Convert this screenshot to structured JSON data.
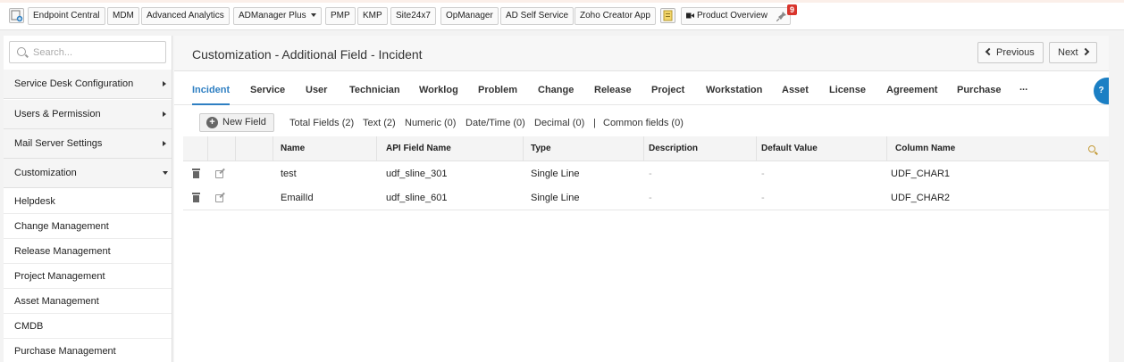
{
  "toolbar": {
    "buttons": [
      {
        "label": "Endpoint Central"
      },
      {
        "label": "MDM"
      },
      {
        "label": "Advanced Analytics"
      },
      {
        "label": "ADManager Plus"
      },
      {
        "label": "PMP"
      },
      {
        "label": "KMP"
      },
      {
        "label": "Site24x7"
      },
      {
        "label": "OpManager"
      },
      {
        "label": "AD Self Service"
      },
      {
        "label": "Zoho Creator App"
      },
      {
        "label": "Product Overview"
      }
    ],
    "notification_count": "9"
  },
  "sidebar": {
    "search_placeholder": "Search...",
    "menu": [
      {
        "label": "Service Desk Configuration"
      },
      {
        "label": "Users & Permission"
      },
      {
        "label": "Mail Server Settings"
      },
      {
        "label": "Customization"
      }
    ],
    "sub_items": [
      {
        "label": "Helpdesk"
      },
      {
        "label": "Change Management"
      },
      {
        "label": "Release Management"
      },
      {
        "label": "Project Management"
      },
      {
        "label": "Asset Management"
      },
      {
        "label": "CMDB"
      },
      {
        "label": "Purchase Management"
      }
    ]
  },
  "main": {
    "title": "Customization - Additional Field - Incident",
    "previous_label": "Previous",
    "next_label": "Next",
    "tabs": [
      {
        "label": "Incident"
      },
      {
        "label": "Service"
      },
      {
        "label": "User"
      },
      {
        "label": "Technician"
      },
      {
        "label": "Worklog"
      },
      {
        "label": "Problem"
      },
      {
        "label": "Change"
      },
      {
        "label": "Release"
      },
      {
        "label": "Project"
      },
      {
        "label": "Workstation"
      },
      {
        "label": "Asset"
      },
      {
        "label": "License"
      },
      {
        "label": "Agreement"
      },
      {
        "label": "Purchase"
      },
      {
        "label": "..."
      }
    ],
    "help_label": "?",
    "new_field_label": "New Field",
    "counts": [
      {
        "label": "Total Fields (2)"
      },
      {
        "label": "Text (2)"
      },
      {
        "label": "Numeric (0)"
      },
      {
        "label": "Date/Time (0)"
      },
      {
        "label": "Decimal (0)"
      },
      {
        "label": "|"
      },
      {
        "label": "Common fields (0)"
      }
    ],
    "table": {
      "columns": [
        "Name",
        "API Field Name",
        "Type",
        "Description",
        "Default Value",
        "Column Name"
      ],
      "rows": [
        {
          "name": "test",
          "api": "udf_sline_301",
          "type": "Single Line",
          "description": "-",
          "default": "-",
          "column": "UDF_CHAR1"
        },
        {
          "name": "EmailId",
          "api": "udf_sline_601",
          "type": "Single Line",
          "description": "-",
          "default": "-",
          "column": "UDF_CHAR2"
        }
      ]
    }
  },
  "colors": {
    "accent": "#2e7fc2",
    "help_tab": "#1b7fc4",
    "badge": "#d9342b"
  }
}
